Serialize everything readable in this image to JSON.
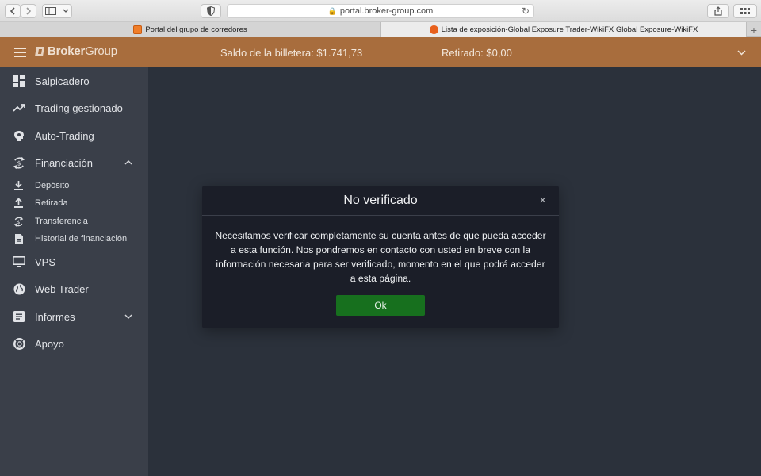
{
  "browser": {
    "url": "portal.broker-group.com",
    "tabs": [
      {
        "label": "Portal del grupo de corredores",
        "active": false
      },
      {
        "label": "Lista de exposición-Global Exposure Trader-WikiFX Global Exposure-WikiFX",
        "active": true
      }
    ]
  },
  "header": {
    "logo_bold": "Broker",
    "logo_regular": "Group",
    "balance": "Saldo de la billetera: $1.741,73",
    "withdrawn": "Retirado: $0,00",
    "color": "#a86d3d"
  },
  "sidebar": {
    "items": [
      {
        "label": "Salpicadero",
        "icon": "dashboard-icon"
      },
      {
        "label": "Trading gestionado",
        "icon": "trending-up-icon"
      },
      {
        "label": "Auto-Trading",
        "icon": "robot-head-icon"
      },
      {
        "label": "Financiación",
        "icon": "money-cycle-icon",
        "expanded": true
      },
      {
        "label": "VPS",
        "icon": "monitor-icon"
      },
      {
        "label": "Web Trader",
        "icon": "globe-icon"
      },
      {
        "label": "Informes",
        "icon": "report-icon",
        "expanded": false
      },
      {
        "label": "Apoyo",
        "icon": "support-icon"
      }
    ],
    "financing_sub": [
      {
        "label": "Depósito",
        "icon": "download-icon"
      },
      {
        "label": "Retirada",
        "icon": "upload-icon"
      },
      {
        "label": "Transferencia",
        "icon": "transfer-icon"
      },
      {
        "label": "Historial de financiación",
        "icon": "history-icon"
      }
    ]
  },
  "modal": {
    "title": "No verificado",
    "close": "×",
    "body": "Necesitamos verificar completamente su cuenta antes de que pueda acceder a esta función. Nos pondremos en contacto con usted en breve con la información necesaria para ser verificado, momento en el que podrá acceder a esta página.",
    "ok_label": "Ok",
    "ok_color": "#17701e"
  }
}
